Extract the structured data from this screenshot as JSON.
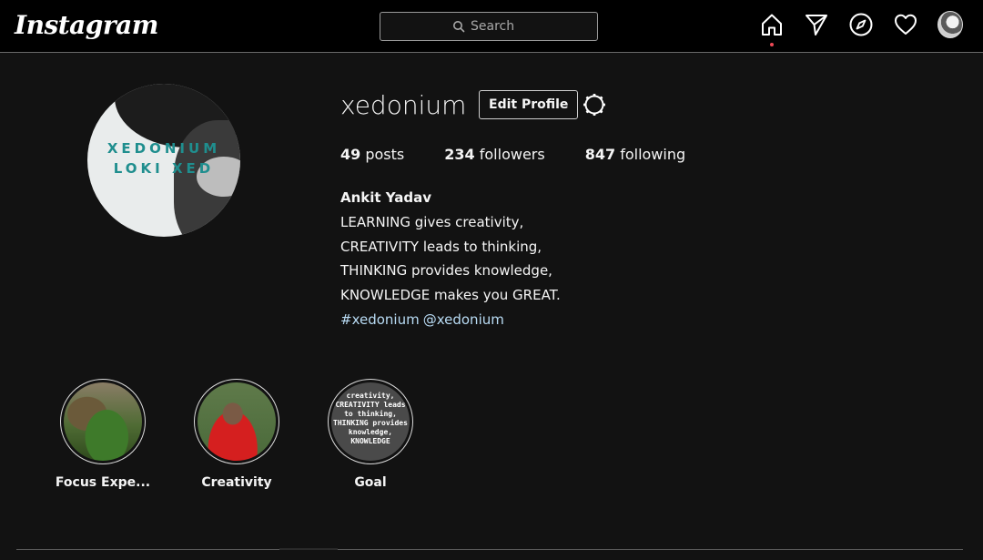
{
  "header": {
    "logo": "Instagram",
    "search_placeholder": "Search",
    "nav": [
      "home-icon",
      "direct-icon",
      "explore-icon",
      "activity-icon",
      "profile-avatar"
    ]
  },
  "profile": {
    "username": "xedonium",
    "edit_label": "Edit Profile",
    "pic_text_line1": "XEDONIUM",
    "pic_text_line2": "LOKI XED",
    "stats": [
      {
        "count": "49",
        "label": "posts"
      },
      {
        "count": "234",
        "label": "followers"
      },
      {
        "count": "847",
        "label": "following"
      }
    ],
    "full_name": "Ankit Yadav",
    "bio_lines": [
      "LEARNING gives creativity,",
      "CREATIVITY leads to thinking,",
      "THINKING provides knowledge,",
      "KNOWLEDGE makes you GREAT."
    ],
    "tags": [
      "#xedonium",
      "@xedonium"
    ]
  },
  "highlights": [
    {
      "label": "Focus Expe..."
    },
    {
      "label": "Creativity"
    },
    {
      "label": "Goal",
      "image_text": [
        "creativity,",
        "CREATIVITY leads",
        "to thinking,",
        "THINKING provides",
        "knowledge,",
        "KNOWLEDGE"
      ]
    }
  ],
  "colors": {
    "background": "#121212",
    "topbar": "#000000",
    "text": "#f5f5f5",
    "link": "#b9dcf5",
    "notification_dot": "#ed4956"
  }
}
